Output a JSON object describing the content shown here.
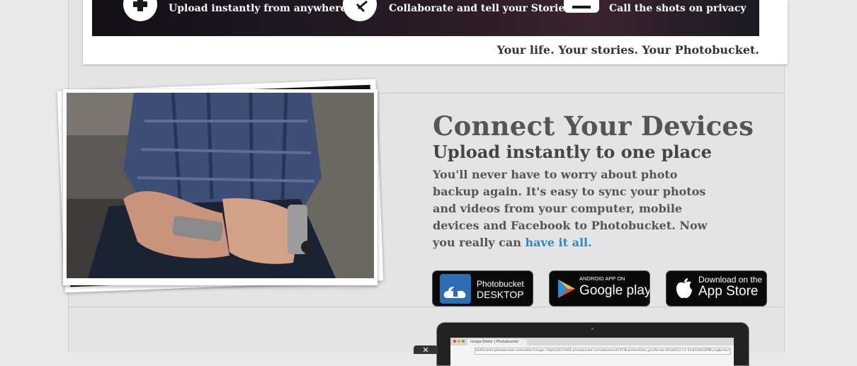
{
  "banner": {
    "features": [
      {
        "icon": "upload-circle-icon",
        "label": "Upload instantly from anywhere"
      },
      {
        "icon": "share-circle-icon",
        "label": "Collaborate and tell your Stories"
      },
      {
        "icon": "privacy-lock-icon",
        "label": "Call the shots on privacy"
      }
    ],
    "tagline": "Your life. Your stories. Your Photobucket."
  },
  "devices": {
    "title": "Connect Your Devices",
    "subtitle": "Upload instantly to one place",
    "body": "You'll never have to worry about photo backup again. It's easy to sync your photos and videos from your computer, mobile devices and Facebook to Photobucket. Now you really can ",
    "link": "have it all.",
    "badges": [
      {
        "name": "photobucket-desktop-badge",
        "line1": "Photobucket",
        "line2": "DESKTOP"
      },
      {
        "name": "google-play-badge",
        "line1": "ANDROID APP ON",
        "line2": "Google play"
      },
      {
        "name": "app-store-badge",
        "line1": "Download on the",
        "line2": "App Store"
      }
    ]
  },
  "browser": {
    "tab_title": "Image Editor | Photobucket",
    "url": "s1002.beta.photobucket.com/editor?image=http%3A//i1002.photobucket.com/albums/af147/Brandonmiller_pro/ScreenShot2012-12-11at140433PM.png&returnTo=http..."
  },
  "close_label": "✕"
}
